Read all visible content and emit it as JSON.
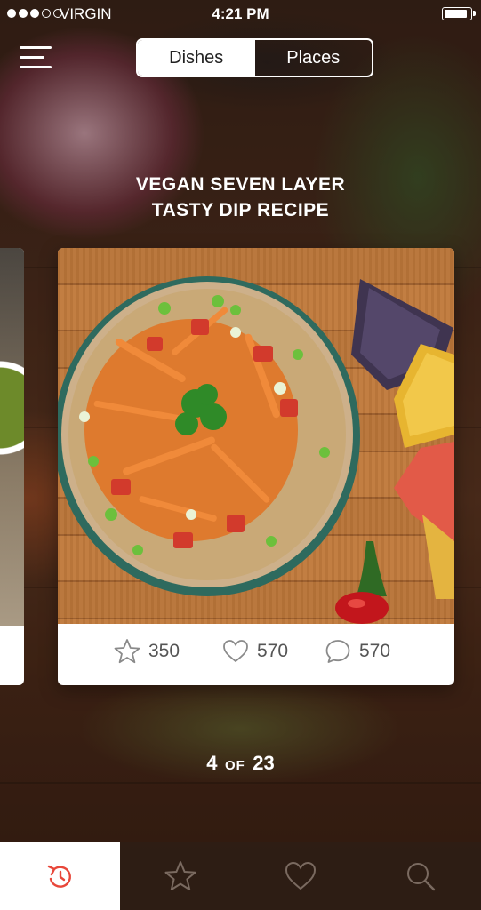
{
  "status_bar": {
    "carrier": "VIRGIN",
    "time": "4:21 PM",
    "signal_bars_on": 3,
    "signal_bars_total": 5,
    "battery_level": 0.92
  },
  "header": {
    "menu_icon": "hamburger-menu-icon",
    "tabs": [
      {
        "label": "Dishes",
        "active": true
      },
      {
        "label": "Places",
        "active": false
      }
    ]
  },
  "recipe": {
    "title_line1": "VEGAN SEVEN LAYER",
    "title_line2": "TASTY DIP RECIPE",
    "stats": {
      "stars": "350",
      "likes": "570",
      "comments": "570"
    }
  },
  "pagination": {
    "current": "4",
    "separator": "OF",
    "total": "23"
  },
  "tab_bar": {
    "items": [
      {
        "icon": "refresh-icon",
        "active": true
      },
      {
        "icon": "star-icon",
        "active": false
      },
      {
        "icon": "heart-icon",
        "active": false
      },
      {
        "icon": "search-icon",
        "active": false
      }
    ]
  },
  "colors": {
    "accent": "#e8473a",
    "icon_gray": "#777777",
    "text_light": "#ffffff"
  }
}
